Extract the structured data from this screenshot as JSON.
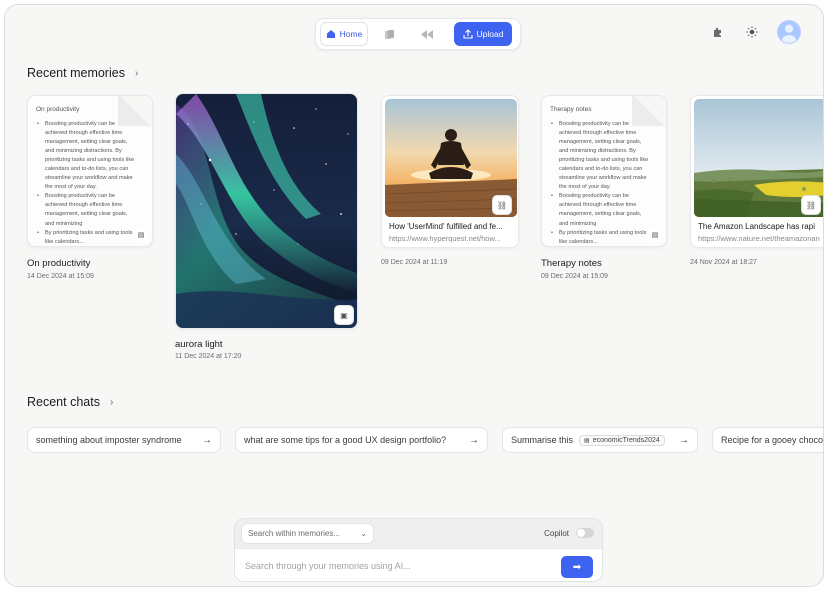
{
  "nav": {
    "home_label": "Home",
    "upload_label": "Upload",
    "accent": "#3e63f0"
  },
  "recent_memories": {
    "title": "Recent memories",
    "items": [
      {
        "type": "note",
        "note_title": "On productivity",
        "bullets": [
          "Boosting productivity can be achieved through effective time management, setting clear goals, and minimizing distractions. By prioritizing tasks and using tools like calendars and to-do lists, you can streamline your workflow and make the most of your day.",
          "Boosting productivity can be achieved through effective time management, setting clear goals, and minimizing",
          "By prioritizing tasks and using tools like calendars..."
        ],
        "title": "On productivity",
        "date": "14 Dec 2024 at 15:09"
      },
      {
        "type": "image",
        "title": "aurora light",
        "date": "11 Dec 2024 at 17:20"
      },
      {
        "type": "link",
        "link_title": "How 'UserMind' fulfilled and fe...",
        "url": "https://www.hyperquest.net/how...",
        "date": "09 Dec 2024 at 11:19"
      },
      {
        "type": "note",
        "note_title": "Therapy notes",
        "bullets": [
          "Boosting productivity can be achieved through effective time management, setting clear goals, and minimizing distractions. By prioritizing tasks and using tools like calendars and to-do lists, you can streamline your workflow and make the most of your day.",
          "Boosting productivity can be achieved through effective time management, setting clear goals, and minimizing",
          "By prioritizing tasks and using tools like calendars..."
        ],
        "title": "Therapy notes",
        "date": "09 Dec 2024 at 15:09"
      },
      {
        "type": "link",
        "link_title": "The Amazon Landscape has rapi",
        "url": "https://www.nature.net/theamazonan",
        "date": "24 Nov 2024 at 18:27"
      }
    ]
  },
  "recent_chats": {
    "title": "Recent chats",
    "items": [
      {
        "text": "something about imposter syndrome",
        "chip": ""
      },
      {
        "text": "what are some tips for a good UX design portfolio?",
        "chip": ""
      },
      {
        "text": "Summarise this",
        "chip": "economicTrends2024"
      },
      {
        "text": "Recipe for a gooey choco",
        "chip": ""
      }
    ]
  },
  "search": {
    "scope_label": "Search within memories...",
    "copilot_label": "Copilot",
    "copilot_on": false,
    "placeholder": "Search through your memories using AI..."
  }
}
